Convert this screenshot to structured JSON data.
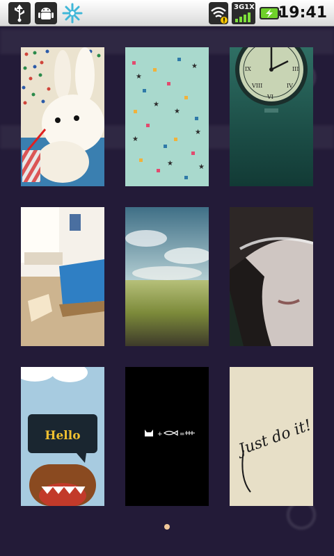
{
  "status_bar": {
    "time": "19:41",
    "signal_label": "3G1X",
    "icons": [
      "usb-icon",
      "android-debug-icon",
      "snowflake-icon",
      "wifi-warning-icon",
      "signal-icon",
      "battery-charging-icon"
    ]
  },
  "background_text": {
    "row1": "",
    "row2": "",
    "row3": "",
    "row4": ""
  },
  "wallpapers": [
    {
      "name": "bunny-wallpaper",
      "theme": "white toy rabbit with drink"
    },
    {
      "name": "confetti-wallpaper",
      "theme": "teal with stars and squares"
    },
    {
      "name": "clock-wallpaper",
      "theme": "green wall clock"
    },
    {
      "name": "bedroom-wallpaper",
      "theme": "bedroom with blue bed"
    },
    {
      "name": "field-wallpaper",
      "theme": "grass field under cloudy sky"
    },
    {
      "name": "face-wallpaper",
      "theme": "face with white hair over eyes"
    },
    {
      "name": "hello-wallpaper",
      "theme": "domo with speech bubble",
      "text": "Hello"
    },
    {
      "name": "cat-fish-wallpaper",
      "theme": "black with cat + fish = bones"
    },
    {
      "name": "just-do-it-wallpaper",
      "theme": "handwritten text on paper",
      "text": "Just do it!"
    }
  ],
  "pager": {
    "current_page": 1,
    "page_count": 1
  },
  "colors": {
    "background": "#231b38",
    "pager_dot": "#f0c89a",
    "status_bar": "#e9e9e9"
  }
}
